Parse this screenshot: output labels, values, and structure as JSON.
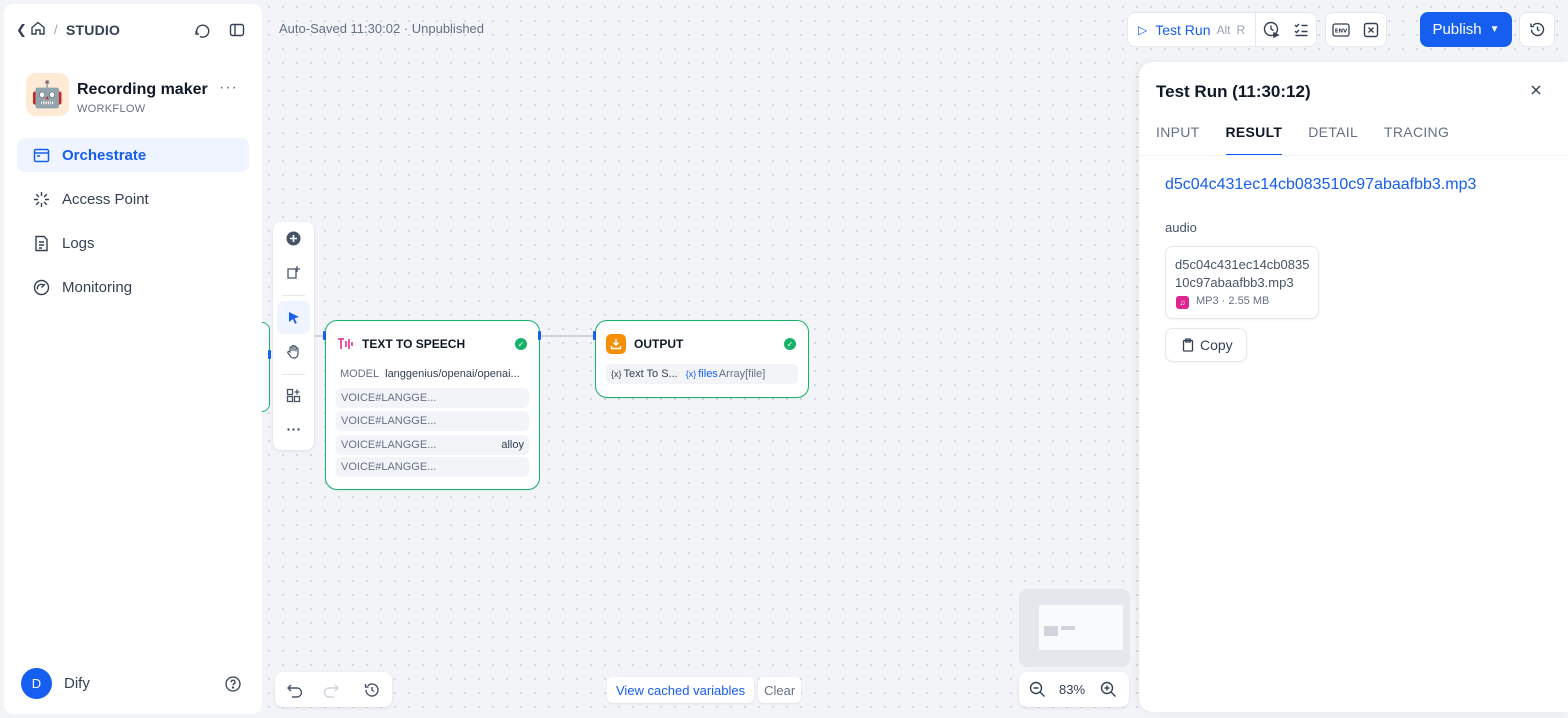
{
  "sidebar": {
    "breadcrumb_sep": "/",
    "studio_label": "STUDIO",
    "app": {
      "name": "Recording maker",
      "type": "WORKFLOW",
      "emoji": "🤖",
      "more": "···"
    },
    "nav": [
      {
        "label": "Orchestrate",
        "icon": "orchestrate-icon",
        "active": true
      },
      {
        "label": "Access Point",
        "icon": "access-point-icon",
        "active": false
      },
      {
        "label": "Logs",
        "icon": "logs-icon",
        "active": false
      },
      {
        "label": "Monitoring",
        "icon": "monitoring-icon",
        "active": false
      }
    ],
    "user": {
      "initial": "D",
      "name": "Dify"
    }
  },
  "header": {
    "autosaved": "Auto-Saved 11:30:02 · Unpublished",
    "test_run": {
      "label": "Test Run",
      "shortcut_1": "Alt",
      "shortcut_2": "R"
    },
    "publish_label": "Publish"
  },
  "nodes": {
    "tts": {
      "title": "TEXT TO SPEECH",
      "model_key": "MODEL",
      "model_value": "langgenius/openai/openai...",
      "voices": [
        {
          "key": "VOICE#LANGGE...",
          "value": ""
        },
        {
          "key": "VOICE#LANGGE...",
          "value": ""
        },
        {
          "key": "VOICE#LANGGE...",
          "value": "alloy"
        },
        {
          "key": "VOICE#LANGGE...",
          "value": ""
        }
      ]
    },
    "output": {
      "title": "OUTPUT",
      "var_prefix": "{x}",
      "var_source": "Text To S...",
      "var_name": "files",
      "var_type": "Array[file]"
    }
  },
  "canvas": {
    "view_cached": "View cached variables",
    "clear": "Clear",
    "zoom": "83%"
  },
  "panel": {
    "title": "Test Run (11:30:12)",
    "tabs": [
      "INPUT",
      "RESULT",
      "DETAIL",
      "TRACING"
    ],
    "active_tab": "RESULT",
    "file_link": "d5c04c431ec14cb083510c97abaafbb3.mp3",
    "audio_label": "audio",
    "file_card": {
      "name": "d5c04c431ec14cb083510c97abaafbb3.mp3",
      "type": "MP3",
      "size": "2.55 MB",
      "meta": "MP3 · 2.55 MB"
    },
    "copy_label": "Copy"
  },
  "colors": {
    "accent": "#155eef",
    "success": "#17b26a",
    "sidebar_active_bg": "#eff4ff",
    "output_icon": "#f79009",
    "tts_icon": "#dd2590"
  }
}
